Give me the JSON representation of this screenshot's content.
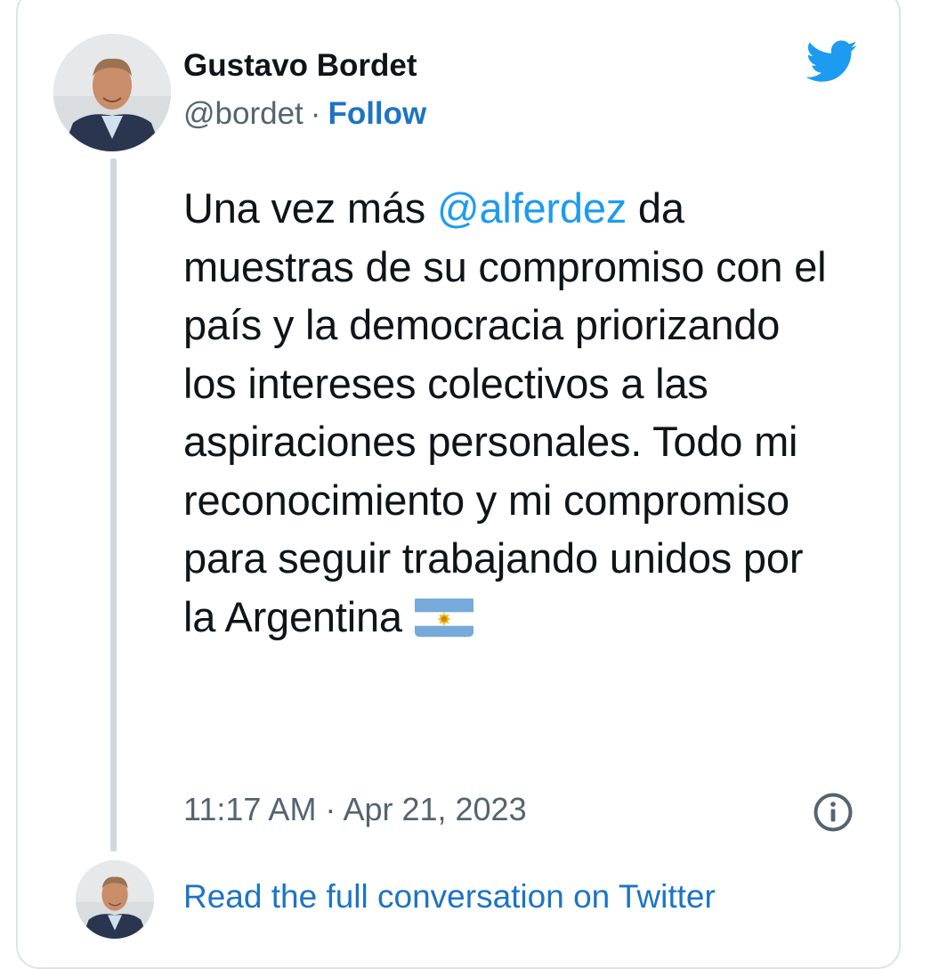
{
  "tweet": {
    "author_name": "Gustavo Bordet",
    "handle": "@bordet",
    "separator": "·",
    "follow_label": "Follow",
    "text_before_mention": "Una vez más ",
    "mention": "@alferdez",
    "text_after_mention": " da muestras de su compromiso con el país y la democracia priorizando los intereses colectivos a las aspiraciones personales. Todo mi reconocimiento y mi compromiso para seguir trabajando unidos por la Argentina",
    "flag_emoji": "argentina-flag",
    "timestamp": "11:17 AM · Apr 21, 2023"
  },
  "footer": {
    "read_more_label": "Read the full conversation on Twitter"
  },
  "icons": {
    "brand": "twitter-bird-icon",
    "info": "info-icon"
  },
  "colors": {
    "link_blue": "#1d74c4",
    "mention_blue": "#1d9bf0",
    "twitter_blue": "#1d9bf0",
    "text": "#0f1419",
    "secondary_text": "#536471",
    "border": "#dde3e8"
  }
}
